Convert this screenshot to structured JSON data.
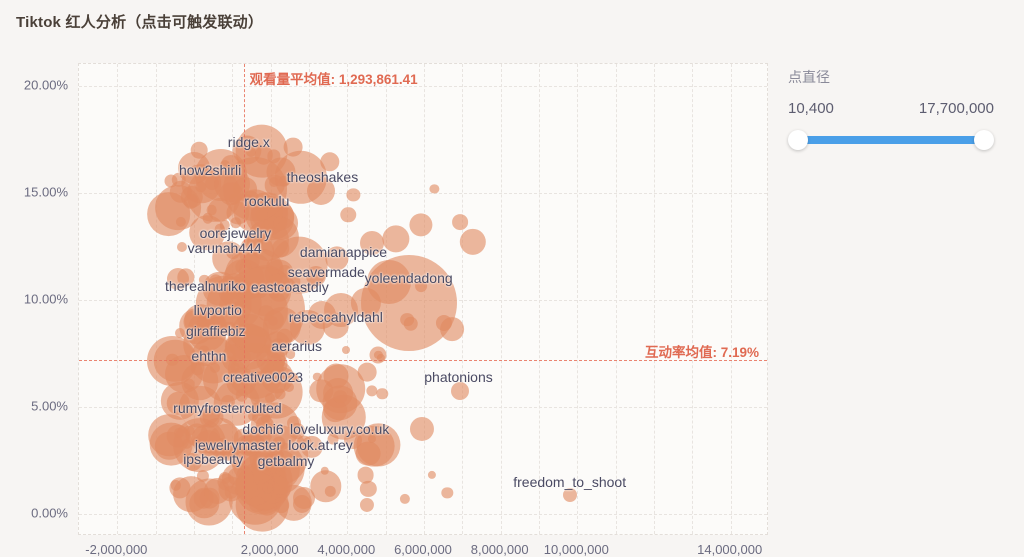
{
  "header": {
    "title": "Tiktok 红人分析（点击可触发联动）"
  },
  "slider_panel": {
    "title": "点直径",
    "min_label": "10,400",
    "max_label": "17,700,000",
    "accent_color": "#4a9fe8",
    "handle_left_pct": 0,
    "handle_right_pct": 100
  },
  "chart_data": {
    "type": "scatter",
    "title": "Tiktok 红人分析（点击可触发联动）",
    "xlabel": "",
    "ylabel": "",
    "xlim": [
      -3000000,
      15000000
    ],
    "ylim": [
      -0.0105,
      0.2105
    ],
    "grid": true,
    "legend": null,
    "xticks": [
      -2000000,
      2000000,
      4000000,
      6000000,
      8000000,
      10000000,
      14000000
    ],
    "xtick_labels": [
      "-2,000,000",
      "2,000,000",
      "4,000,000",
      "6,000,000",
      "8,000,000",
      "10,000,000",
      "14,000,000"
    ],
    "yticks": [
      0,
      0.05,
      0.1,
      0.15,
      0.2
    ],
    "ytick_labels": [
      "0.00%",
      "5.00%",
      "10.00%",
      "15.00%",
      "20.00%"
    ],
    "bubble_color": "#e08b62",
    "size_encodes": "点直径 (观看量)",
    "size_range": [
      10400,
      17700000
    ],
    "reference_lines": [
      {
        "orientation": "vertical",
        "label": "观看量平均值: 1,293,861.41",
        "value": 1293861.41,
        "color": "#e06a52",
        "style": "dashed"
      },
      {
        "orientation": "horizontal",
        "label": "互动率均值: 7.19%",
        "value": 0.0719,
        "color": "#e06a52",
        "style": "dashed"
      }
    ],
    "labeled_points": [
      {
        "name": "ridge.x",
        "x": 1430000,
        "y": 0.174
      },
      {
        "name": "how2shirli",
        "x": 420000,
        "y": 0.161
      },
      {
        "name": "theoshakes",
        "x": 3350000,
        "y": 0.1575
      },
      {
        "name": "rockulu",
        "x": 1900000,
        "y": 0.1465
      },
      {
        "name": "oorejewelry",
        "x": 1080000,
        "y": 0.1315
      },
      {
        "name": "varunah444",
        "x": 800000,
        "y": 0.1245
      },
      {
        "name": "damianappice",
        "x": 3900000,
        "y": 0.1225
      },
      {
        "name": "seavermade",
        "x": 3450000,
        "y": 0.113
      },
      {
        "name": "yoleendadong",
        "x": 5600000,
        "y": 0.1105
      },
      {
        "name": "therealnuriko",
        "x": 300000,
        "y": 0.1065
      },
      {
        "name": "eastcoastdiy",
        "x": 2500000,
        "y": 0.106
      },
      {
        "name": "livportio",
        "x": 620000,
        "y": 0.0955
      },
      {
        "name": "rebeccahyldahl",
        "x": 3700000,
        "y": 0.092
      },
      {
        "name": "giraffiebiz",
        "x": 570000,
        "y": 0.0855
      },
      {
        "name": "ehthn",
        "x": 390000,
        "y": 0.074
      },
      {
        "name": "aerarius",
        "x": 2680000,
        "y": 0.0785
      },
      {
        "name": "creative0023",
        "x": 1800000,
        "y": 0.064
      },
      {
        "name": "phatonions",
        "x": 6900000,
        "y": 0.064
      },
      {
        "name": "rumyfroster",
        "x": 380000,
        "y": 0.0495
      },
      {
        "name": "culted",
        "x": 1800000,
        "y": 0.0495
      },
      {
        "name": "dochi6",
        "x": 1800000,
        "y": 0.0395
      },
      {
        "name": "loveluxury.co.uk",
        "x": 3800000,
        "y": 0.0395
      },
      {
        "name": "jewelrymaster",
        "x": 1150000,
        "y": 0.032
      },
      {
        "name": "look.at.rey",
        "x": 3300000,
        "y": 0.032
      },
      {
        "name": "ipsbeauty",
        "x": 500000,
        "y": 0.0255
      },
      {
        "name": "getbalmy",
        "x": 2400000,
        "y": 0.0245
      },
      {
        "name": "freedom_to_shoot",
        "x": 9800000,
        "y": 0.015
      }
    ]
  }
}
